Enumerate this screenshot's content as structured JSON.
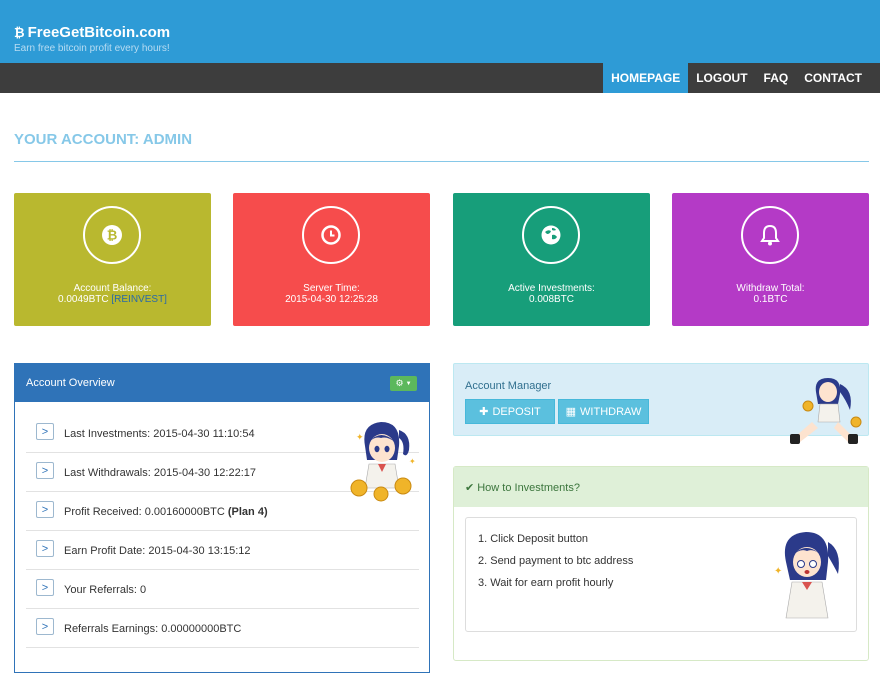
{
  "site": {
    "brand_icon": "bitcoin-icon",
    "name": "FreeGetBitcoin.com",
    "tagline": "Earn free bitcoin profit every hours!"
  },
  "nav": {
    "items": [
      "HOMEPAGE",
      "LOGOUT",
      "FAQ",
      "CONTACT"
    ],
    "active": "HOMEPAGE"
  },
  "account_title": "YOUR ACCOUNT: ADMIN",
  "cards": [
    {
      "icon": "bitcoin-icon",
      "label": "Account Balance:",
      "value": "0.0049BTC",
      "link": "[REINVEST]",
      "color": "#b9b82f"
    },
    {
      "icon": "clock-icon",
      "label": "Server Time:",
      "value": "2015-04-30 12:25:28",
      "color": "#f64c4c"
    },
    {
      "icon": "globe-icon",
      "label": "Active Investments:",
      "value": "0.008BTC",
      "color": "#179e7a"
    },
    {
      "icon": "bell-icon",
      "label": "Withdraw Total:",
      "value": "0.1BTC",
      "color": "#b43ac6"
    }
  ],
  "overview": {
    "title": "Account Overview",
    "settings_icon": "gear-icon",
    "rows": [
      {
        "text": "Last Investments: 2015-04-30 11:10:54"
      },
      {
        "text": "Last Withdrawals: 2015-04-30 12:22:17"
      },
      {
        "text": "Profit Received: 0.00160000BTC ",
        "bold": "(Plan 4)"
      },
      {
        "text": "Earn Profit Date: 2015-04-30 13:15:12"
      },
      {
        "text": "Your Referrals: 0"
      },
      {
        "text": "Referrals Earnings: 0.00000000BTC"
      }
    ]
  },
  "manager": {
    "title": "Account Manager",
    "deposit": "DEPOSIT",
    "withdraw": "WITHDRAW"
  },
  "howto": {
    "title": "How to Investments?",
    "steps": [
      "1. Click Deposit button",
      "2. Send payment to btc address",
      "3. Wait for earn profit hourly"
    ]
  }
}
